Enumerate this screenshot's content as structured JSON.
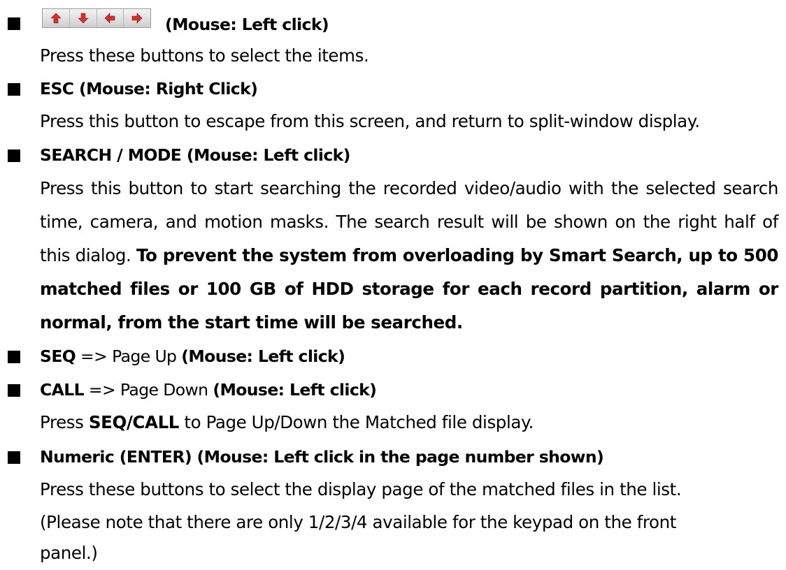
{
  "sections": {
    "arrows": {
      "icons": [
        "up-arrow-icon",
        "down-arrow-icon",
        "left-arrow-icon",
        "right-arrow-icon"
      ],
      "icon_color": "#d0312d",
      "heading": "(Mouse: Left click)",
      "desc": "Press these buttons to select the items."
    },
    "esc": {
      "heading": "ESC (Mouse: Right Click)",
      "desc": "Press this button to escape from this screen, and return to split-window display."
    },
    "search": {
      "heading": "SEARCH / MODE (Mouse: Left click)",
      "desc": "Press this button to start searching the recorded video/audio with the selected search time, camera, and motion masks.   The search result will be shown on the right half of this dialog.",
      "desc_bold": "To prevent the system from overloading by Smart Search, up to 500 matched files or 100 GB of HDD storage for each record partition, alarm or normal, from the start time will be searched."
    },
    "seq": {
      "key": "SEQ",
      "action": " => Page Up ",
      "mouse": "(Mouse: Left click)"
    },
    "call": {
      "key": "CALL",
      "action": " => Page Down ",
      "mouse": "(Mouse: Left click)",
      "desc_prefix": "Press ",
      "desc_key": "SEQ/CALL",
      "desc_suffix": " to Page Up/Down the Matched file display."
    },
    "numeric": {
      "heading": "Numeric (ENTER) (Mouse: Left click in the page number shown)",
      "desc_line1": "Press these buttons to select the display page of the matched files in the list.",
      "desc_line2": "(Please note that there are only 1/2/3/4 available for the keypad on the front",
      "desc_line3": "panel.)"
    }
  }
}
